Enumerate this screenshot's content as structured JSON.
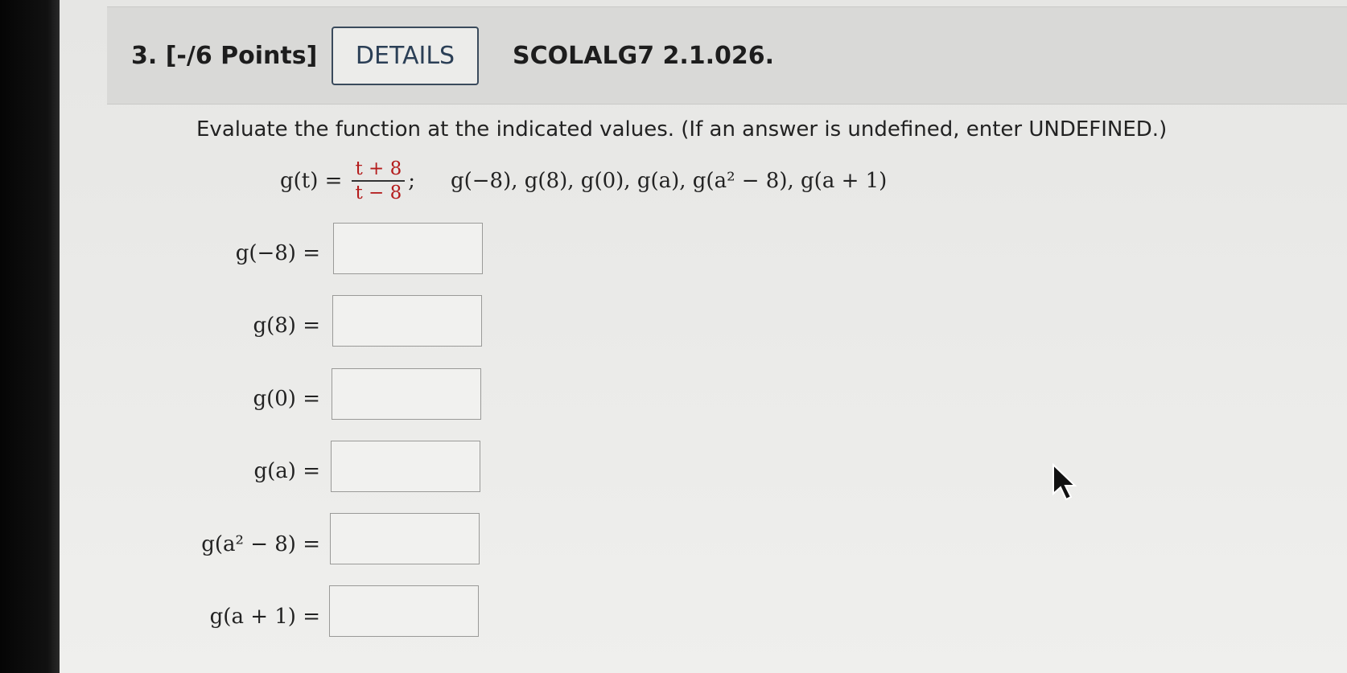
{
  "question": {
    "number_points": "3. [-/6 Points]",
    "details_label": "DETAILS",
    "source": "SCOLALG7 2.1.026."
  },
  "instruction": "Evaluate the function at the indicated values. (If an answer is undefined, enter UNDEFINED.)",
  "function": {
    "lhs": "g(t) =",
    "numerator": "t + 8",
    "denominator": "t − 8",
    "separator": ";",
    "values_list": [
      "g(−8)",
      "g(8)",
      "g(0)",
      "g(a)",
      "g(a² − 8)",
      "g(a + 1)"
    ]
  },
  "answers": [
    {
      "label": "g(−8) =",
      "value": ""
    },
    {
      "label": "g(8) =",
      "value": ""
    },
    {
      "label": "g(0) =",
      "value": ""
    },
    {
      "label": "g(a) =",
      "value": ""
    },
    {
      "label": "g(a² − 8) =",
      "value": ""
    },
    {
      "label": "g(a + 1) =",
      "value": ""
    }
  ],
  "colors": {
    "accent_red": "#b41c1c",
    "details_border": "#3a4a5c"
  }
}
